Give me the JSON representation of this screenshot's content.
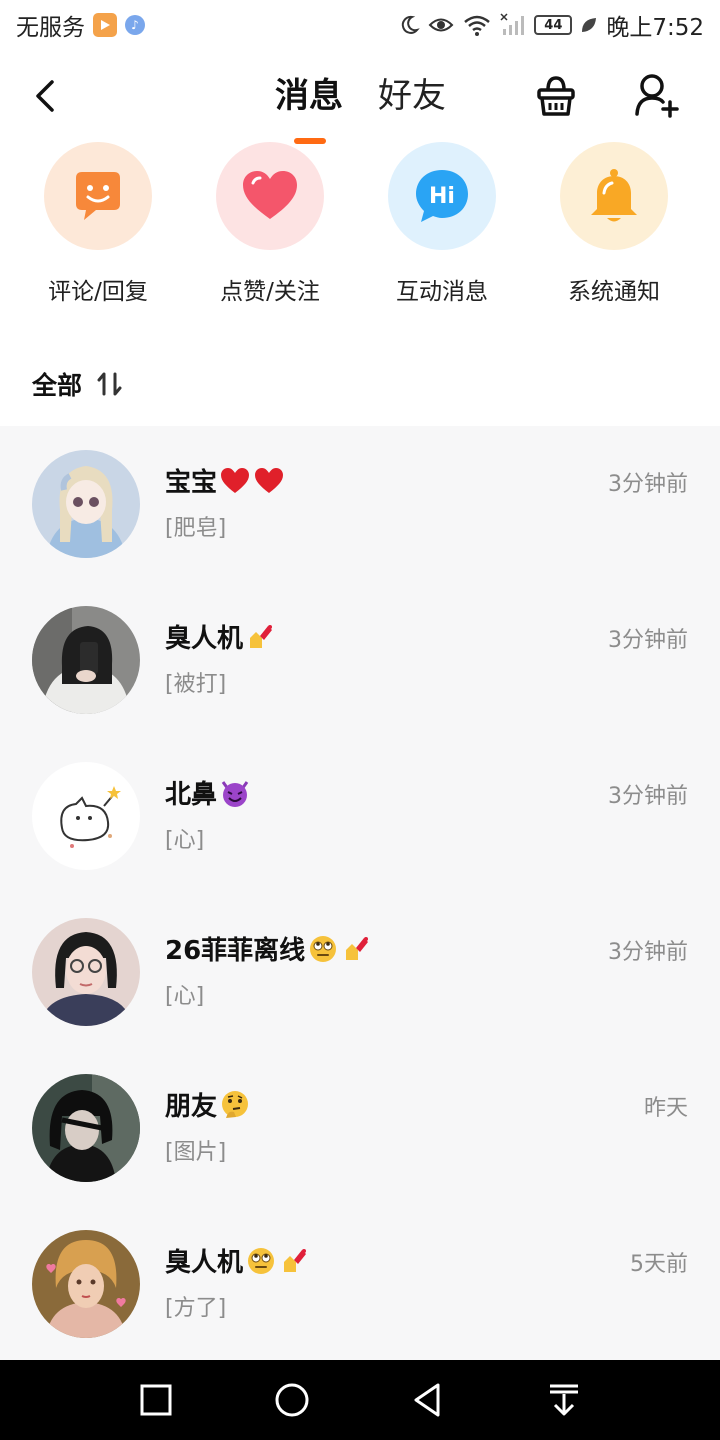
{
  "status_bar": {
    "carrier": "无服务",
    "battery": "44",
    "time": "晚上7:52"
  },
  "header": {
    "tabs": [
      {
        "label": "消息",
        "active": true
      },
      {
        "label": "好友",
        "active": false
      }
    ],
    "icons": [
      "back-icon",
      "clean-basket-icon",
      "add-friend-icon"
    ],
    "accent_color": "#ff6a13"
  },
  "categories": [
    {
      "label": "评论/回复",
      "icon": "comment-smile-icon",
      "color": "#f7883a"
    },
    {
      "label": "点赞/关注",
      "icon": "heart-icon",
      "color": "#f4566b"
    },
    {
      "label": "互动消息",
      "icon": "hi-bubble-icon",
      "color": "#2aa4f4"
    },
    {
      "label": "系统通知",
      "icon": "bell-icon",
      "color": "#f9a825"
    }
  ],
  "filter": {
    "label": "全部",
    "icon": "sort-icon"
  },
  "messages": [
    {
      "name": "宝宝",
      "emojis": [
        "red-heart-emoji",
        "red-heart-emoji"
      ],
      "preview": "[肥皂]",
      "time": "3分钟前"
    },
    {
      "name": "臭人机",
      "emojis": [
        "nail-polish-emoji"
      ],
      "preview": "[被打]",
      "time": "3分钟前"
    },
    {
      "name": "北鼻",
      "emojis": [
        "smiling-devil-emoji"
      ],
      "preview": "[心]",
      "time": "3分钟前"
    },
    {
      "name": "26菲菲离线",
      "emojis": [
        "eye-roll-emoji",
        "nail-polish-emoji"
      ],
      "preview": "[心]",
      "time": "3分钟前"
    },
    {
      "name": "朋友",
      "emojis": [
        "thinking-emoji"
      ],
      "preview": "[图片]",
      "time": "昨天"
    },
    {
      "name": "臭人机",
      "emojis": [
        "eye-roll-emoji",
        "nail-polish-emoji"
      ],
      "preview": "[方了]",
      "time": "5天前"
    }
  ]
}
